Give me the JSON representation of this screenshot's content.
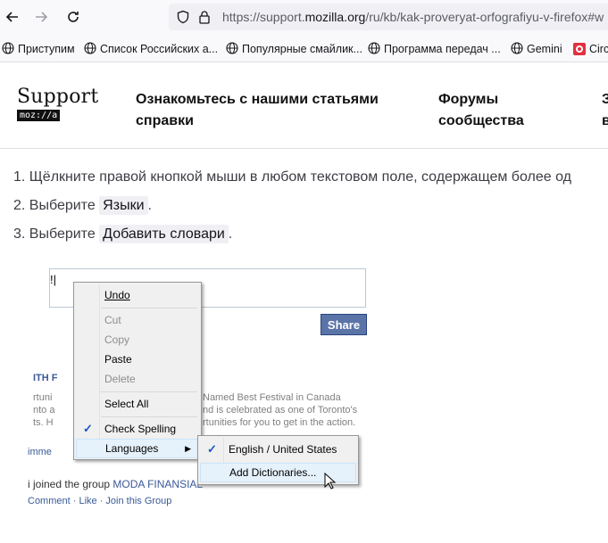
{
  "browser": {
    "url_prefix": "https://support.",
    "url_domain": "mozilla.org",
    "url_rest": "/ru/kb/kak-proveryat-orfografiyu-v-firefox#w",
    "bookmarks": [
      "Приступим",
      "Список Российских а...",
      "Популярные смайлик...",
      "Программа передач ...",
      "Gemini",
      "Circ"
    ]
  },
  "header": {
    "logo_word": "Support",
    "logo_sub": "moz://a",
    "nav": [
      "Ознакомьтесь с нашими статьями справки",
      "Форумы сообщества",
      "З в"
    ]
  },
  "article": {
    "step1": "1. Щёлкните правой кнопкой мыши в любом текстовом поле, содержащем более од",
    "step2_prefix": "2. Выберите ",
    "step2_kbd": "Языки",
    "step2_suffix": ".",
    "step3_prefix": "3. Выберите ",
    "step3_kbd": "Добавить словари",
    "step3_suffix": "."
  },
  "screenshot": {
    "share_label": "Share",
    "fb_texts": {
      "heading": "ITH F",
      "line1a": "rtuni",
      "line1b": "Named Best Festival in Canada",
      "line2a": "nto a",
      "line2b": "nd is celebrated as one of Toronto's",
      "line3a": "ts. H",
      "line3b": "rtunities for you to get in the action.",
      "comment": "imme",
      "joined_pre": "i joined the group ",
      "joined_group": "MODA FINANSIAL",
      "actions": "Comment · Like · Join this Group"
    },
    "context_menu": {
      "undo": "Undo",
      "cut": "Cut",
      "copy": "Copy",
      "paste": "Paste",
      "delete": "Delete",
      "select_all": "Select All",
      "check_spelling": "Check Spelling",
      "languages": "Languages"
    },
    "submenu": {
      "english": "English / United States",
      "add_dictionaries": "Add Dictionaries..."
    }
  },
  "colors": {
    "accent": "#3b5998",
    "check": "#1a55c8"
  }
}
